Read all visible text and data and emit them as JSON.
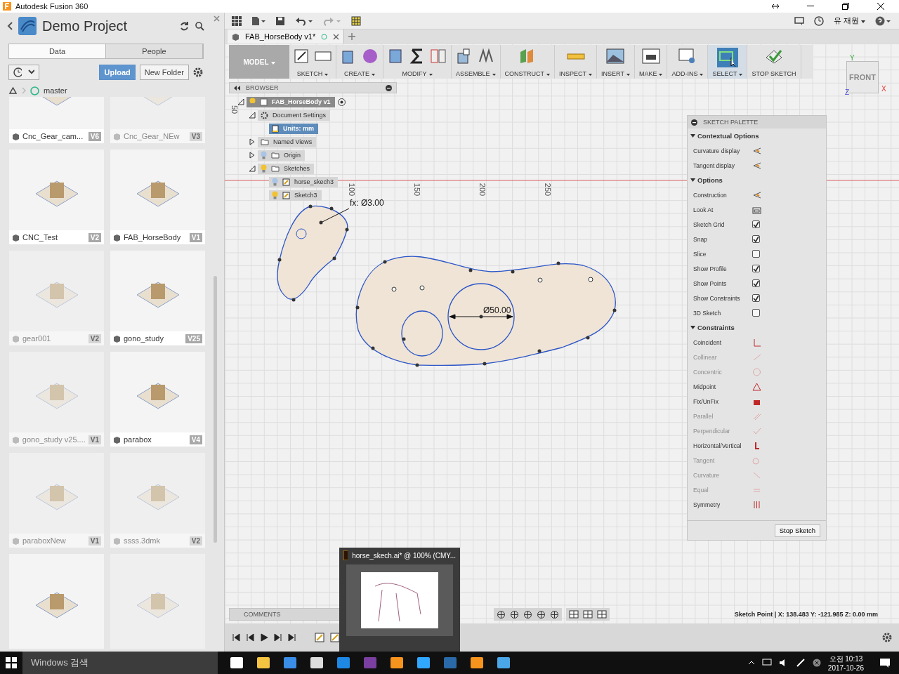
{
  "title_bar": {
    "app_title": "Autodesk Fusion 360"
  },
  "data_panel": {
    "project": "Demo Project",
    "tabs": [
      {
        "label": "Data",
        "selected": true
      },
      {
        "label": "People",
        "selected": false
      }
    ],
    "upload": "Upload",
    "new_folder": "New Folder",
    "branch": "master",
    "files": [
      {
        "name": "Cnc_Gear_cam...",
        "version": "V6",
        "dimmed": false
      },
      {
        "name": "Cnc_Gear_NEw",
        "version": "V3",
        "dimmed": true
      },
      {
        "name": "CNC_Test",
        "version": "V2",
        "dimmed": false
      },
      {
        "name": "FAB_HorseBody",
        "version": "V1",
        "dimmed": false
      },
      {
        "name": "gear001",
        "version": "V2",
        "dimmed": true
      },
      {
        "name": "gono_study",
        "version": "V25",
        "dimmed": false
      },
      {
        "name": "gono_study v25....",
        "version": "V1",
        "dimmed": true
      },
      {
        "name": "parabox",
        "version": "V4",
        "dimmed": false
      },
      {
        "name": "paraboxNew",
        "version": "V1",
        "dimmed": true
      },
      {
        "name": "ssss.3dmk",
        "version": "V2",
        "dimmed": true
      },
      {
        "dimmed": false
      },
      {
        "dimmed": true
      }
    ]
  },
  "quick_bar": {
    "user": "유 재원"
  },
  "document_tabs": [
    {
      "label": "FAB_HorseBody v1*",
      "selected": true
    }
  ],
  "toolbar": {
    "workspace": "MODEL",
    "groups": [
      {
        "label": "SKETCH",
        "selected": false
      },
      {
        "label": "CREATE",
        "selected": false
      },
      {
        "label": "MODIFY",
        "selected": false
      },
      {
        "label": "ASSEMBLE",
        "selected": false
      },
      {
        "label": "CONSTRUCT",
        "selected": false
      },
      {
        "label": "INSPECT",
        "selected": false
      },
      {
        "label": "INSERT",
        "selected": false
      },
      {
        "label": "MAKE",
        "selected": false
      },
      {
        "label": "ADD-INS",
        "selected": false
      },
      {
        "label": "SELECT",
        "selected": true
      },
      {
        "label": "STOP SKETCH",
        "selected": false
      }
    ]
  },
  "browser": {
    "title": "BROWSER",
    "tree": [
      {
        "label": "FAB_HorseBody v1",
        "kind": "component",
        "visible": true,
        "expanded": true,
        "selected": false,
        "children": [
          {
            "label": "Document Settings",
            "kind": "settings",
            "expanded": true,
            "selected": false,
            "children": [
              {
                "label": "Units: mm",
                "kind": "units",
                "selected": true
              }
            ]
          },
          {
            "label": "Named Views",
            "kind": "folder",
            "expanded": false,
            "selected": false
          },
          {
            "label": "Origin",
            "kind": "folder",
            "visible": false,
            "expanded": false,
            "selected": false
          },
          {
            "label": "Sketches",
            "kind": "folder",
            "visible": true,
            "expanded": true,
            "selected": false,
            "children": [
              {
                "label": "horse_skech3",
                "kind": "sketch",
                "visible": false,
                "selected": false
              },
              {
                "label": "Sketch3",
                "kind": "sketch",
                "visible": true,
                "selected": false
              }
            ]
          }
        ]
      }
    ]
  },
  "canvas": {
    "ruler_labels": [
      "50",
      "100",
      "150",
      "200",
      "250"
    ],
    "dimension_labels": [
      "fx: Ø3.00",
      "Ø50.00"
    ],
    "view_cube": "FRONT",
    "axes": [
      "Y",
      "X",
      "Z"
    ],
    "comments": "COMMENTS",
    "status": "Sketch Point | X: 138.483 Y: -121.985 Z: 0.00 mm"
  },
  "sketch_palette": {
    "title": "SKETCH PALETTE",
    "sections": [
      {
        "title": "Contextual Options",
        "expanded": true,
        "items": [
          {
            "kind": "action",
            "label": "Curvature display"
          },
          {
            "kind": "action",
            "label": "Tangent display"
          }
        ]
      },
      {
        "title": "Options",
        "expanded": true,
        "items": [
          {
            "kind": "action",
            "label": "Construction"
          },
          {
            "kind": "look",
            "label": "Look At"
          },
          {
            "kind": "checkbox",
            "label": "Sketch Grid",
            "checked": true
          },
          {
            "kind": "checkbox",
            "label": "Snap",
            "checked": true
          },
          {
            "kind": "checkbox",
            "label": "Slice",
            "checked": false
          },
          {
            "kind": "checkbox",
            "label": "Show Profile",
            "checked": true
          },
          {
            "kind": "checkbox",
            "label": "Show Points",
            "checked": true
          },
          {
            "kind": "checkbox",
            "label": "Show Constraints",
            "checked": true
          },
          {
            "kind": "checkbox",
            "label": "3D Sketch",
            "checked": false
          }
        ]
      },
      {
        "title": "Constraints",
        "expanded": true,
        "items": [
          {
            "kind": "constraint",
            "label": "Coincident",
            "disabled": false
          },
          {
            "kind": "constraint",
            "label": "Collinear",
            "disabled": true
          },
          {
            "kind": "constraint",
            "label": "Concentric",
            "disabled": true
          },
          {
            "kind": "constraint",
            "label": "Midpoint",
            "disabled": false
          },
          {
            "kind": "constraint",
            "label": "Fix/UnFix",
            "disabled": false
          },
          {
            "kind": "constraint",
            "label": "Parallel",
            "disabled": true
          },
          {
            "kind": "constraint",
            "label": "Perpendicular",
            "disabled": true
          },
          {
            "kind": "constraint",
            "label": "Horizontal/Vertical",
            "disabled": false
          },
          {
            "kind": "constraint",
            "label": "Tangent",
            "disabled": true
          },
          {
            "kind": "constraint",
            "label": "Curvature",
            "disabled": true
          },
          {
            "kind": "constraint",
            "label": "Equal",
            "disabled": true
          },
          {
            "kind": "constraint",
            "label": "Symmetry",
            "disabled": false
          }
        ]
      }
    ],
    "stop_button": "Stop Sketch"
  },
  "preview_popup": {
    "title": "horse_skech.ai* @ 100% (CMY..."
  },
  "taskbar": {
    "search": "Windows 검색",
    "time": "오전 10:13",
    "date": "2017-10-26"
  }
}
